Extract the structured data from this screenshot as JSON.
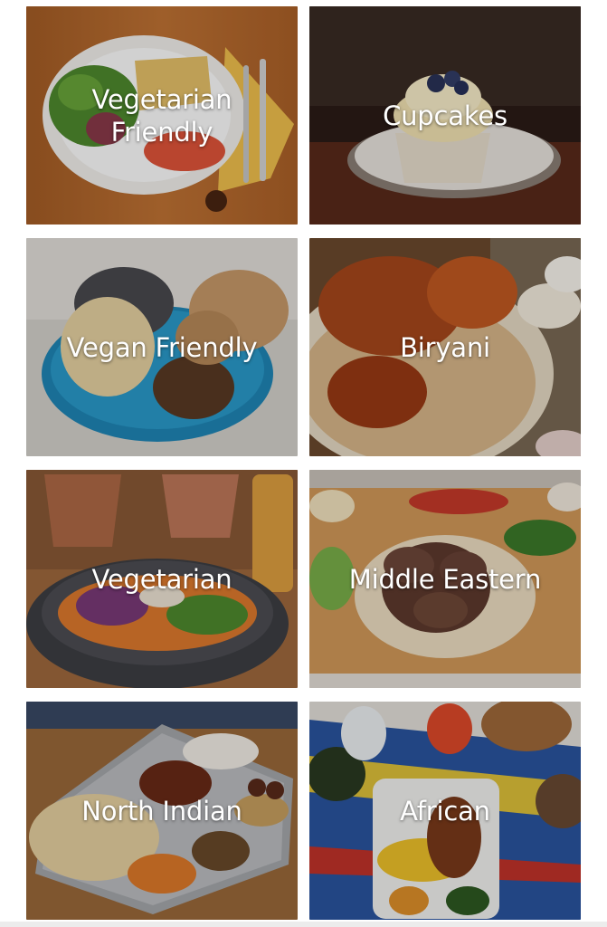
{
  "categories": [
    {
      "label": "Vegetarian\nFriendly"
    },
    {
      "label": "Cupcakes"
    },
    {
      "label": "Vegan Friendly"
    },
    {
      "label": "Biryani"
    },
    {
      "label": "Vegetarian"
    },
    {
      "label": "Middle Eastern"
    },
    {
      "label": "North Indian"
    },
    {
      "label": "African"
    }
  ]
}
